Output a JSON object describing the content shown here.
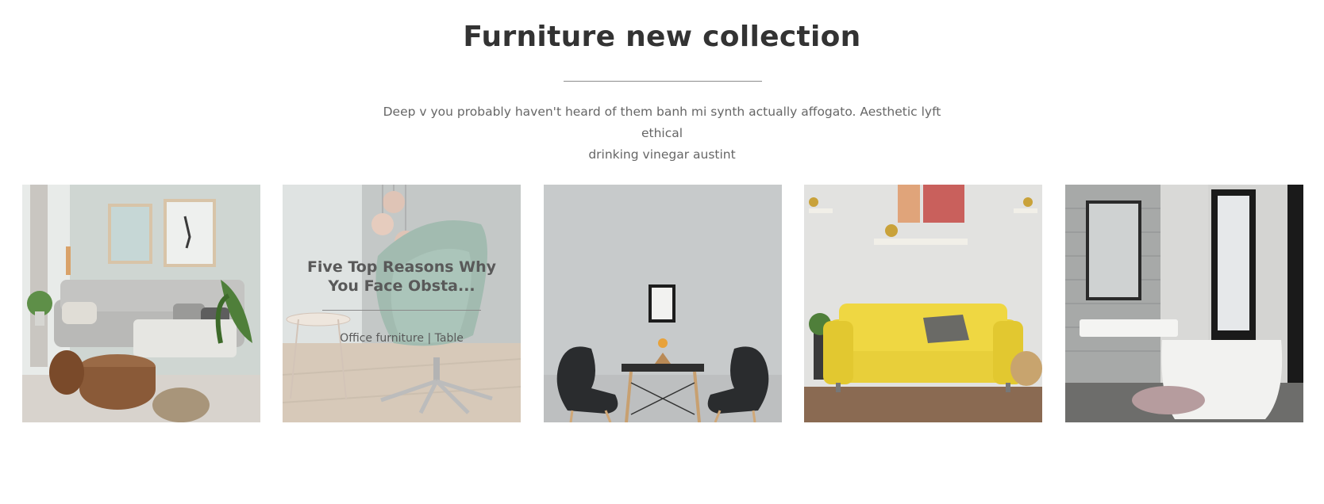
{
  "section": {
    "title": "Furniture new collection",
    "description_line1": "Deep v you probably haven't heard of them banh mi synth actually affogato. Aesthetic lyft ethical",
    "description_line2": "drinking vinegar austint"
  },
  "gallery": {
    "items": [
      {
        "image": "living-room-grey-sofa-photo"
      },
      {
        "image": "green-lounge-chair-pendant-lamps-photo",
        "overlay_title_line1": "Five Top Reasons Why",
        "overlay_title_line2": "You Face Obsta...",
        "category": "Office furniture",
        "separator": "|",
        "tag": "Table"
      },
      {
        "image": "dining-table-two-black-chairs-photo"
      },
      {
        "image": "yellow-sofa-wall-shelf-photo"
      },
      {
        "image": "bathroom-bathtub-mirror-photo"
      }
    ]
  }
}
